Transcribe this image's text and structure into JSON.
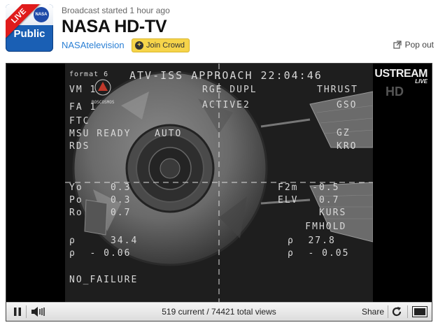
{
  "logo": {
    "live_label": "LIVE",
    "nasa_label": "NASA",
    "public_label": "Public"
  },
  "header": {
    "broadcast_status": "Broadcast started 1 hour ago",
    "title": "NASA HD-TV",
    "channel_name": "NASAtelevision",
    "join_label": "Join Crowd",
    "popout_label": "Pop out"
  },
  "video": {
    "osd_top": "ATV-ISS APPROACH 22:04:46",
    "osd_left": [
      "VM 1",
      "FA 1",
      "FTC",
      "MSU READY",
      "RDS"
    ],
    "osd_center_top": [
      "RGE DUPL",
      "ACTIVE2"
    ],
    "osd_auto": "AUTO",
    "osd_right_top": [
      "THRUST",
      "GSO",
      "",
      "GZ",
      "KRO"
    ],
    "osd_left_mid": [
      "Yo    0.3",
      "Po    0.3",
      "Ro    0.7"
    ],
    "osd_right_mid": [
      "F2m  -0.5",
      "ELV   0.7",
      "      KURS",
      "    FMHOLD"
    ],
    "osd_left_low": [
      "ρ     34.4",
      "ρ  - 0.06"
    ],
    "osd_right_low": [
      "ρ  27.8",
      "ρ  - 0.05"
    ],
    "osd_failure": "NO_FAILURE",
    "osd_format": "format 6",
    "agency": "ROSCOSMOS",
    "watermark": "USTREAM",
    "watermark_sub": "LIVE",
    "hd_mark": "HD"
  },
  "controls": {
    "current_viewers": "519",
    "current_label": "current",
    "total_views": "74421",
    "total_label": "total views",
    "share_label": "Share"
  }
}
